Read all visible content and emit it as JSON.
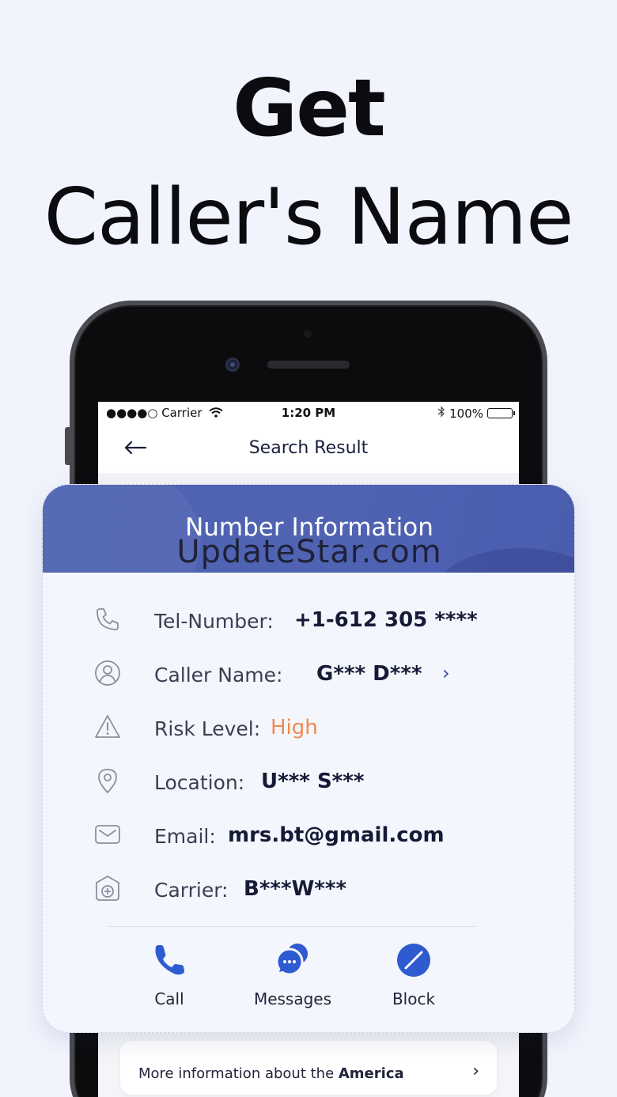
{
  "headline": {
    "line1": "Get",
    "line2": "Caller's Name"
  },
  "status_bar": {
    "signal_carrier": "●●●●○ Carrier",
    "time": "1:20 PM",
    "battery": "100%"
  },
  "nav": {
    "back_icon": "arrow-left-icon",
    "title": "Search Result"
  },
  "card": {
    "title": "Number Information",
    "watermark": "UpdateStar.com",
    "rows": [
      {
        "icon": "phone-icon",
        "label": "Tel-Number:",
        "value": "+1-612 305 ****"
      },
      {
        "icon": "user-icon",
        "label": "Caller Name:",
        "value": "G*** D***",
        "has_chevron": true
      },
      {
        "icon": "warning-icon",
        "label": "Risk Level:",
        "value": "High"
      },
      {
        "icon": "location-icon",
        "label": "Location:",
        "value": "U*** S***"
      },
      {
        "icon": "mail-icon",
        "label": "Email:",
        "value": "mrs.bt@gmail.com"
      },
      {
        "icon": "carrier-icon",
        "label": "Carrier:",
        "value": "B***W***"
      }
    ],
    "actions": [
      {
        "icon": "phone-call-icon",
        "label": "Call"
      },
      {
        "icon": "messages-icon",
        "label": "Messages"
      },
      {
        "icon": "block-icon",
        "label": "Block"
      }
    ]
  },
  "more_info": {
    "prefix": "More information about the ",
    "country": "America",
    "chevron": "›"
  },
  "colors": {
    "background": "#f1f4fc",
    "header_blue": "#4f63b2",
    "action_blue": "#2f5bd0",
    "risk_orange": "#f08a4e",
    "value_navy": "#151a36"
  }
}
